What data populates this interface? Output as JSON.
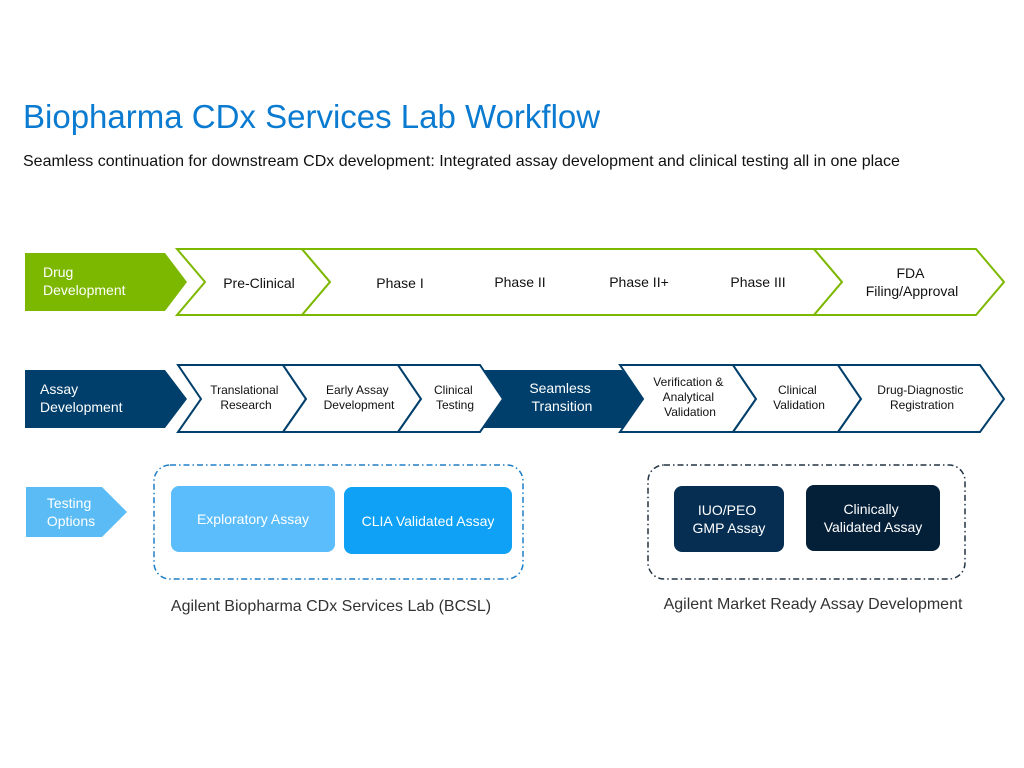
{
  "header": {
    "title": "Biopharma CDx Services Lab Workflow",
    "subtitle": "Seamless continuation for downstream CDx development: Integrated assay development and clinical testing all in one place"
  },
  "colors": {
    "title_blue": "#0a7bd0",
    "drug_green": "#7db800",
    "assay_navy": "#003f6b",
    "testing_light_blue": "#5bbcf5",
    "exploratory_blue": "#5bbdfc",
    "clia_blue": "#0ea1f5",
    "iuo_navy": "#052e52",
    "clinically_navy": "#041f38"
  },
  "drug_row": {
    "header": [
      "Drug",
      "Development"
    ],
    "stages": [
      {
        "lines": [
          "Pre-Clinical"
        ]
      },
      {
        "lines": [
          "Phase I"
        ]
      },
      {
        "lines": [
          "Phase II"
        ]
      },
      {
        "lines": [
          "Phase II+"
        ]
      },
      {
        "lines": [
          "Phase III"
        ]
      },
      {
        "lines": [
          "FDA",
          "Filing/Approval"
        ]
      }
    ]
  },
  "assay_row": {
    "header": [
      "Assay",
      "Development"
    ],
    "stages": [
      {
        "lines": [
          "Translational",
          "Research"
        ]
      },
      {
        "lines": [
          "Early Assay",
          "Development"
        ]
      },
      {
        "lines": [
          "Clinical",
          "Testing"
        ]
      },
      {
        "lines": [
          "Seamless",
          "Transition"
        ],
        "highlight": true
      },
      {
        "lines": [
          "Verification &",
          "Analytical",
          "Validation"
        ]
      },
      {
        "lines": [
          "Clinical",
          "Validation"
        ]
      },
      {
        "lines": [
          "Drug-Diagnostic",
          "Registration"
        ]
      }
    ]
  },
  "testing_row": {
    "header": [
      "Testing",
      "Options"
    ],
    "groups": [
      {
        "caption": "Agilent Biopharma CDx Services Lab (BCSL)",
        "boxes": [
          {
            "lines": [
              "Exploratory Assay"
            ]
          },
          {
            "lines": [
              "CLIA Validated Assay"
            ]
          }
        ]
      },
      {
        "caption": "Agilent Market Ready Assay Development",
        "boxes": [
          {
            "lines": [
              "IUO/PEO",
              "GMP Assay"
            ]
          },
          {
            "lines": [
              "Clinically",
              "Validated Assay"
            ]
          }
        ]
      }
    ]
  }
}
